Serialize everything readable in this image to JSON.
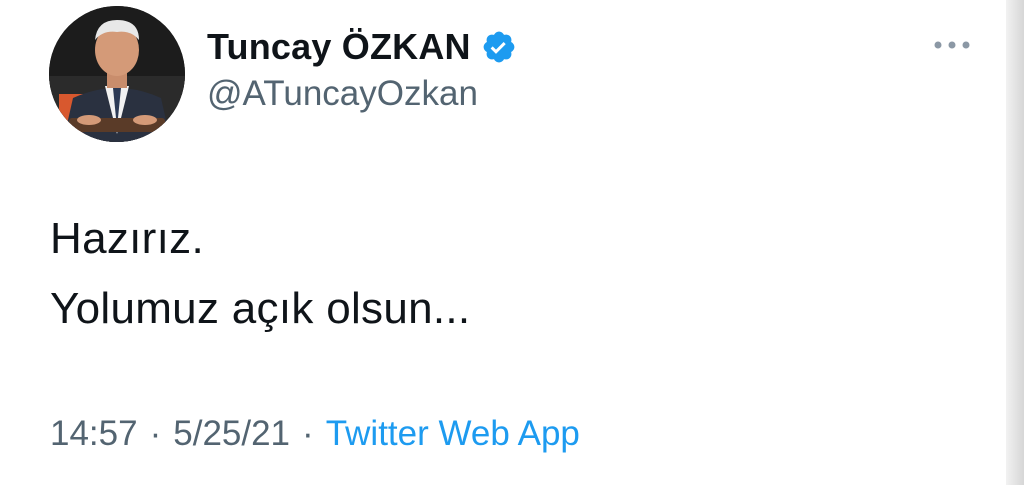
{
  "tweet": {
    "author": {
      "display_name": "Tuncay ÖZKAN",
      "handle": "@ATuncayOzkan",
      "verified_icon": "verified-badge-icon",
      "avatar": "profile-photo",
      "verified_color": "#1d9bf0"
    },
    "more_icon": "more-options-icon",
    "text_lines": [
      "Hazırız.",
      "Yolumuz açık olsun..."
    ],
    "meta": {
      "time": "14:57",
      "separator": "·",
      "date": "5/25/21",
      "source": "Twitter Web App"
    }
  }
}
